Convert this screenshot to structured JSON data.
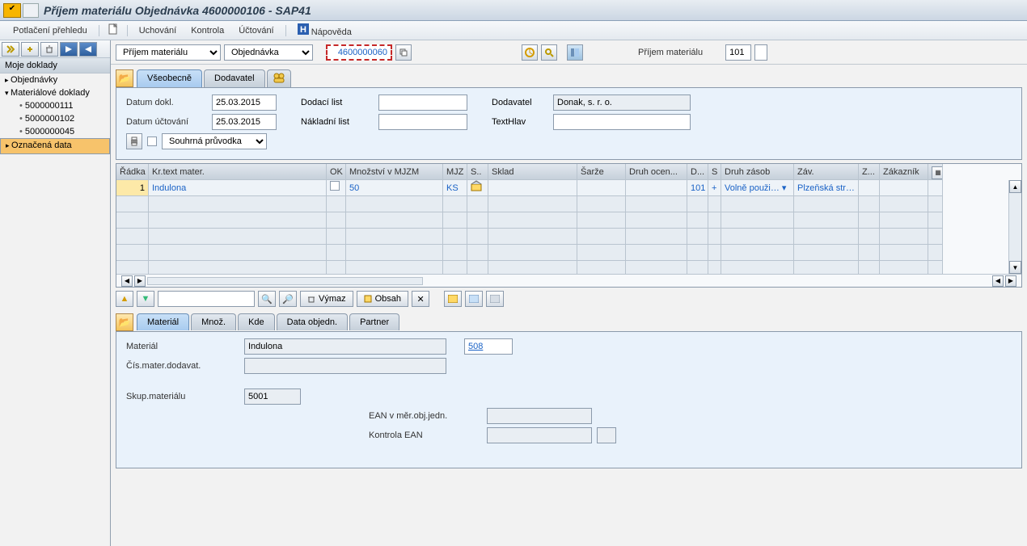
{
  "title": "Příjem materiálu Objednávka 4600000106 - SAP41",
  "menu": {
    "potlaceni": "Potlačení přehledu",
    "uchovani": "Uchování",
    "kontrola": "Kontrola",
    "uctovani": "Účtování",
    "napoveda": "Nápověda"
  },
  "tree": {
    "title": "Moje doklady",
    "items": [
      {
        "label": "Objednávky",
        "type": "node"
      },
      {
        "label": "Materiálové doklady",
        "type": "node",
        "open": true,
        "children": [
          {
            "label": "5000000111"
          },
          {
            "label": "5000000102"
          },
          {
            "label": "5000000045"
          }
        ]
      },
      {
        "label": "Označená data",
        "type": "node",
        "sel": true
      }
    ]
  },
  "toolbar": {
    "action": "Příjem materiálu",
    "reftype": "Objednávka",
    "docno": "4600000060",
    "label_right": "Příjem materiálu",
    "movetype": "101"
  },
  "header_tabs": [
    "Všeobecně",
    "Dodavatel"
  ],
  "header": {
    "datum_dokl_lbl": "Datum dokl.",
    "datum_dokl": "25.03.2015",
    "datum_uct_lbl": "Datum účtování",
    "datum_uct": "25.03.2015",
    "dodaci_lbl": "Dodací list",
    "nakladni_lbl": "Nákladní list",
    "dodavatel_lbl": "Dodavatel",
    "dodavatel": "Donak, s. r. o.",
    "texthlav_lbl": "TextHlav",
    "souhrnna": "Souhrná průvodka"
  },
  "table": {
    "cols": [
      "Řádka",
      "Kr.text mater.",
      "OK",
      "Množství v MJZM",
      "MJZ",
      "S..",
      "Sklad",
      "Šarže",
      "Druh ocen...",
      "D...",
      "S",
      "Druh zásob",
      "Záv.",
      "Z...",
      "Zákazník"
    ],
    "widths": [
      40,
      220,
      24,
      120,
      30,
      26,
      110,
      60,
      76,
      26,
      16,
      90,
      80,
      26,
      60
    ],
    "row": {
      "radka": "1",
      "text": "Indulona",
      "mnozstvi": "50",
      "mjz": "KS",
      "d": "101",
      "s": "+",
      "druh_zasob": "Volně použi…",
      "zav": "Plzeňská str…"
    }
  },
  "btool": {
    "vymaz": "Výmaz",
    "obsah": "Obsah"
  },
  "detail_tabs": [
    "Materiál",
    "Množ.",
    "Kde",
    "Data objedn.",
    "Partner"
  ],
  "detail": {
    "material_lbl": "Materiál",
    "material": "Indulona",
    "material_no": "508",
    "cis_lbl": "Čís.mater.dodavat.",
    "skup_lbl": "Skup.materiálu",
    "skup": "5001",
    "ean_lbl": "EAN v měr.obj.jedn.",
    "kontrola_lbl": "Kontrola EAN"
  }
}
